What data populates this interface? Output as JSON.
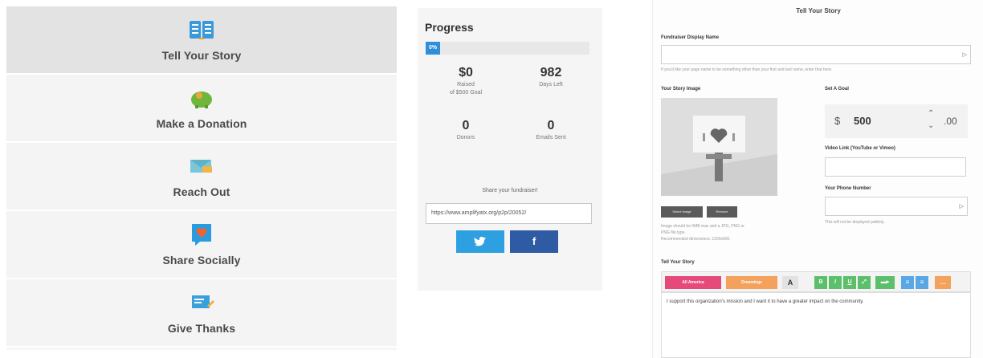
{
  "steps": [
    {
      "label": "Tell Your Story",
      "icon": "book-icon",
      "active": true
    },
    {
      "label": "Make a Donation",
      "icon": "piggy-bank-icon",
      "active": false
    },
    {
      "label": "Reach Out",
      "icon": "email-icon",
      "active": false
    },
    {
      "label": "Share Socially",
      "icon": "heart-speech-bubble-icon",
      "active": false
    },
    {
      "label": "Give Thanks",
      "icon": "thank-you-card-icon",
      "active": false
    }
  ],
  "progress": {
    "title": "Progress",
    "percent_label": "0%",
    "percent": 0,
    "raised_value": "$0",
    "raised_caption": "Raised",
    "raised_caption2": "of $500 Goal",
    "days_value": "982",
    "days_caption": "Days Left",
    "donors_value": "0",
    "donors_caption": "Donors",
    "emails_value": "0",
    "emails_caption": "Emails Sent",
    "share_label": "Share your fundraiser!",
    "share_url": "https://www.amplifyatx.org/p2p/20052/"
  },
  "social": {
    "twitter_icon": "twitter-bird-icon",
    "facebook_glyph": "f",
    "twitter_color": "#2e9fe0",
    "facebook_color": "#2f5aa4"
  },
  "form": {
    "title": "Tell Your Story",
    "display_name_label": "Fundraiser Display Name",
    "display_name_hint": "If you'd like your page name to be something other than your first and last name, enter that here.",
    "story_image_label": "Your Story Image",
    "select_image_btn": "Select Image",
    "remove_btn": "Remove",
    "image_hint_1": "Image should be 5MB max and a JPG, PNG or",
    "image_hint_2": "PNG file type.",
    "image_hint_3": "Recommended dimensions: 1200x600.",
    "goal_label": "Set A Goal",
    "goal_currency": "$",
    "goal_amount": "500",
    "goal_cents": ".00",
    "video_label": "Video Link (YouTube or Vimeo)",
    "phone_label": "Your Phone Number",
    "phone_hint": "This will not be displayed publicly.",
    "story_label": "Tell Your Story",
    "toolbar": {
      "merge_fields": "All America",
      "templates": "Dreamings",
      "font_color": "A",
      "bold": "B",
      "italic": "I",
      "underline": "U",
      "link": "⤢",
      "align_left": "≡",
      "align_center": "≡",
      "more": "…"
    },
    "story_text": "I support this organization's mission and I want it to have a greater impact on the community."
  }
}
